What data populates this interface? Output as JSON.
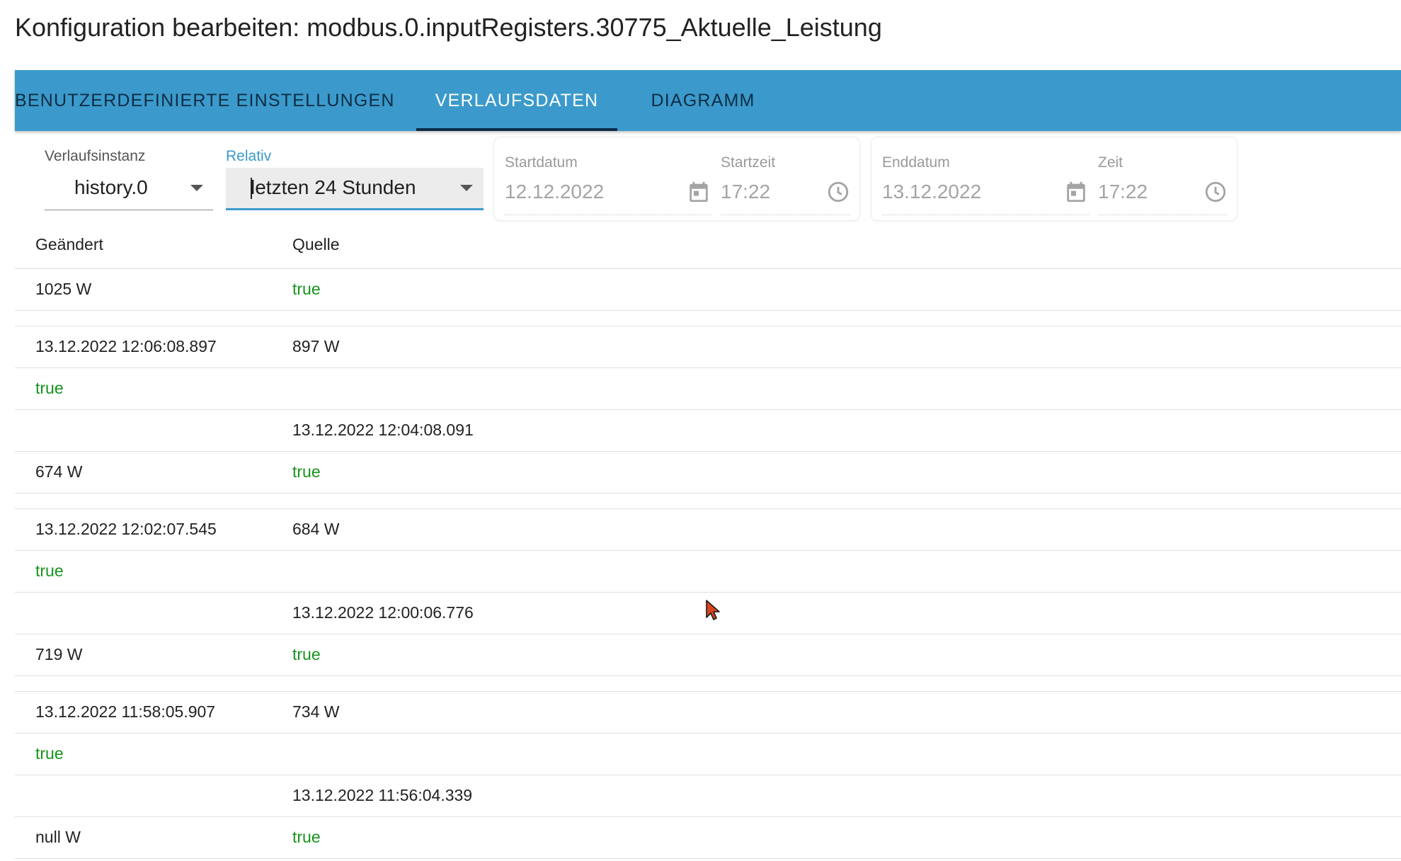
{
  "dialog": {
    "title": "Konfiguration bearbeiten: modbus.0.inputRegisters.30775_Aktuelle_Leistung"
  },
  "tabs": [
    {
      "label": "BENUTZERDEFINIERTE EINSTELLUNGEN",
      "active": false
    },
    {
      "label": "VERLAUFSDATEN",
      "active": true
    },
    {
      "label": "DIAGRAMM",
      "active": false
    }
  ],
  "filters": {
    "instance": {
      "label": "Verlaufsinstanz",
      "value": "history.0"
    },
    "relative": {
      "label": "Relativ",
      "value": "letzten 24 Stunden"
    },
    "start": {
      "date_label": "Startdatum",
      "date_value": "12.12.2022",
      "time_label": "Startzeit",
      "time_value": "17:22"
    },
    "end": {
      "date_label": "Enddatum",
      "date_value": "13.12.2022",
      "time_label": "Zeit",
      "time_value": "17:22"
    }
  },
  "table": {
    "headers": [
      "Geändert",
      "Quelle"
    ],
    "rows": [
      {
        "col1": "1025 W",
        "col2": "true"
      },
      {
        "col1": "13.12.2022 12:06:08.897",
        "col2": "897 W"
      },
      {
        "col1": "true",
        "col2": ""
      },
      {
        "col1": "",
        "col2": "13.12.2022 12:04:08.091"
      },
      {
        "col1": "674 W",
        "col2": "true"
      },
      {
        "col1": "13.12.2022 12:02:07.545",
        "col2": "684 W"
      },
      {
        "col1": "true",
        "col2": ""
      },
      {
        "col1": "",
        "col2": "13.12.2022 12:00:06.776"
      },
      {
        "col1": "719 W",
        "col2": "true"
      },
      {
        "col1": "13.12.2022 11:58:05.907",
        "col2": "734 W"
      },
      {
        "col1": "true",
        "col2": ""
      },
      {
        "col1": "",
        "col2": "13.12.2022 11:56:04.339"
      },
      {
        "col1": "null W",
        "col2": "true"
      }
    ]
  },
  "colors": {
    "tab_bar": "#3b9acb",
    "ack_true": "#15941b",
    "focus": "#3b9acb"
  },
  "icons": {
    "date": "calendar-icon",
    "time": "clock-icon",
    "pointer": "mouse-cursor"
  }
}
